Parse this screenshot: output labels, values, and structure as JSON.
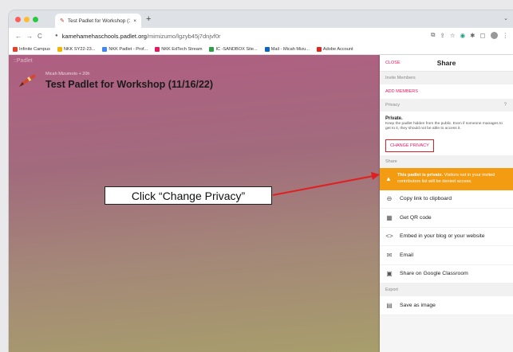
{
  "browser": {
    "tab_title": "Test Padlet for Workshop (11/1(",
    "tab_close": "×",
    "new_tab": "+",
    "url_domain": "kamehamehaschools.padlet.org",
    "url_path": "/mimizumo/lgzyb45j7dnjvf0r",
    "bookmarks": [
      {
        "label": "Infinite Campus",
        "color": "#e7412a"
      },
      {
        "label": "NKK SY22-23...",
        "color": "#f4b400"
      },
      {
        "label": "NKK Padlet - Prof...",
        "color": "#4285f4"
      },
      {
        "label": "NKK EdTech Stream",
        "color": "#e6195f"
      },
      {
        "label": "IC -SANDBOX Site...",
        "color": "#2f9e44"
      },
      {
        "label": "Mail - Micah Mizu...",
        "color": "#0a66c2"
      },
      {
        "label": "Adobe Account",
        "color": "#e3241b"
      }
    ]
  },
  "padlet": {
    "logo": "::Padlet",
    "author": "Micah Mizumoto + 20h",
    "title": "Test Padlet for Workshop (11/16/22)"
  },
  "callout": {
    "text": "Click “Change Privacy”"
  },
  "share_panel": {
    "close_label": "CLOSE",
    "title": "Share",
    "invite_header": "Invite Members",
    "add_members": "ADD MEMBERS",
    "privacy_header": "Privacy",
    "privacy_title": "Private.",
    "privacy_desc": "Keep the padlet hidden from the public. Even if someone manages to get to it, they should not be able to access it.",
    "change_privacy": "CHANGE PRIVACY",
    "share_header": "Share",
    "warning_bold": "This padlet is private.",
    "warning_rest": " Visitors not in your invited contributors list will be denied access.",
    "share_items": [
      {
        "label": "Copy link to clipboard",
        "icon": "⊖"
      },
      {
        "label": "Get QR code",
        "icon": "▦"
      },
      {
        "label": "Embed in your blog or your website",
        "icon": "<>"
      },
      {
        "label": "Email",
        "icon": "✉"
      },
      {
        "label": "Share on Google Classroom",
        "icon": "▣"
      }
    ],
    "export_header": "Export",
    "export_items": [
      {
        "label": "Save as image",
        "icon": "▤"
      }
    ]
  },
  "colors": {
    "accent": "#e6195f",
    "warning": "#f39c12",
    "callout_border": "#e02020"
  }
}
